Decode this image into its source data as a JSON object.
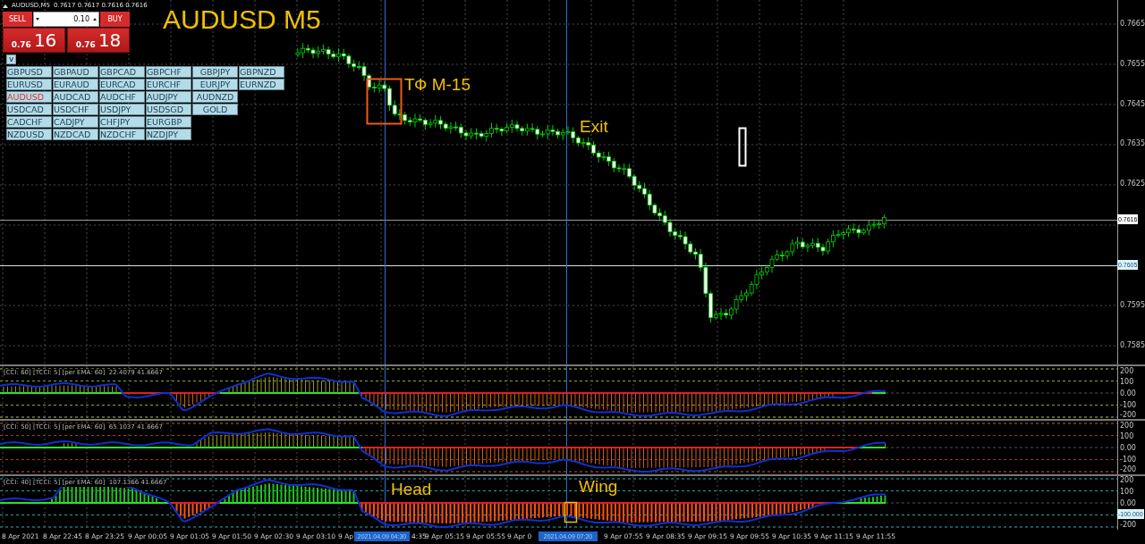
{
  "chart_header": {
    "symbol": "AUDUSD,M5",
    "quotes": "0.7617 0.7617 0.7616 0.7616"
  },
  "trade_panel": {
    "sell_label": "SELL",
    "buy_label": "BUY",
    "volume": "0.10",
    "sell_price": {
      "prefix": "0.76",
      "big": "16"
    },
    "buy_price": {
      "prefix": "0.76",
      "big": "18"
    }
  },
  "symbol_toggle": "v",
  "symbol_rows": [
    {
      "items": [
        {
          "label": "GBPUSD",
          "selected": false
        },
        {
          "label": "GBPAUD",
          "selected": false
        },
        {
          "label": "GBPCAD",
          "selected": false
        },
        {
          "label": "GBPCHF",
          "selected": false
        },
        {
          "label": "GBPJPY",
          "selected": false
        },
        {
          "label": "GBPNZD",
          "selected": false
        }
      ]
    },
    {
      "items": [
        {
          "label": "EURUSD",
          "selected": false
        },
        {
          "label": "EURAUD",
          "selected": false
        },
        {
          "label": "EURCAD",
          "selected": false
        },
        {
          "label": "EURCHF",
          "selected": false
        },
        {
          "label": "EURJPY",
          "selected": false
        },
        {
          "label": "EURNZD",
          "selected": false
        }
      ]
    },
    {
      "items": [
        {
          "label": "AUDUSD",
          "selected": true
        },
        {
          "label": "AUDCAD",
          "selected": false
        },
        {
          "label": "AUDCHF",
          "selected": false
        },
        {
          "label": "AUDJPY",
          "selected": false
        },
        {
          "label": "AUDNZD",
          "selected": false
        }
      ]
    },
    {
      "items": [
        {
          "label": "USDCAD",
          "selected": false
        },
        {
          "label": "USDCHF",
          "selected": false
        },
        {
          "label": "USDJPY",
          "selected": false
        },
        {
          "label": "USDSGD",
          "selected": false
        },
        {
          "label": "GOLD",
          "selected": false
        }
      ]
    },
    {
      "items": [
        {
          "label": "CADCHF",
          "selected": false
        },
        {
          "label": "CADJPY",
          "selected": false
        },
        {
          "label": "CHFJPY",
          "selected": false
        },
        {
          "label": "EURGBP",
          "selected": false
        }
      ]
    },
    {
      "items": [
        {
          "label": "NZDUSD",
          "selected": false
        },
        {
          "label": "NZDCAD",
          "selected": false
        },
        {
          "label": "NZDCHF",
          "selected": false
        },
        {
          "label": "NZDJPY",
          "selected": false
        }
      ]
    }
  ],
  "title": "AUDUSD M5",
  "annotations": [
    {
      "text": "ТФ M-15"
    },
    {
      "text": "Exit"
    }
  ],
  "price_axis": {
    "labels": [
      "0.7665",
      "0.7655",
      "0.7645",
      "0.7635",
      "0.7625",
      "0.7595",
      "0.7585"
    ],
    "markers": [
      {
        "text": "0.7616",
        "kind": "bid"
      },
      {
        "text": "0.7605",
        "kind": "line"
      }
    ]
  },
  "indicators": [
    {
      "header": "[CCI: 60] [TCCI: 5] [per EMA: 60]  22.4079 41.6667",
      "axis": [
        "200",
        "100",
        "0.00",
        "-100",
        "-200"
      ]
    },
    {
      "header": "[CCI: 50] [TCCI: 5] [per EMA: 60]  65.1037 41.6667",
      "axis": [
        "200",
        "100",
        "0.00",
        "-100",
        "-200"
      ]
    },
    {
      "header": "[CCI: 40] [TCCI: 5] [per EMA: 60]  107.1366 41.6667",
      "axis": [
        "200",
        "100",
        "0.00",
        "-200"
      ],
      "marker": "-100.000",
      "annotations": [
        {
          "text": "Head"
        },
        {
          "text": "Wing"
        }
      ]
    }
  ],
  "time_axis": {
    "labels": [
      "8 Apr 2021",
      "8 Apr 22:45",
      "8 Apr 23:25",
      "9 Apr 00:05",
      "9 Apr 01:05",
      "9 Apr 01:50",
      "9 Apr 02:30",
      "9 Apr 03:10",
      "9 Ap",
      "4:35",
      "9 Apr 05:15",
      "9 Apr 05:55",
      "9 Apr 0",
      "9 Apr 07:55",
      "9 Apr 08:35",
      "9 Apr 09:15",
      "9 Apr 09:55",
      "9 Apr 10:35",
      "9 Apr 11:15",
      "9 Apr 11:55"
    ],
    "highlights": [
      "2021.04.09 04:30",
      "2021.04.09 07:20"
    ]
  }
}
